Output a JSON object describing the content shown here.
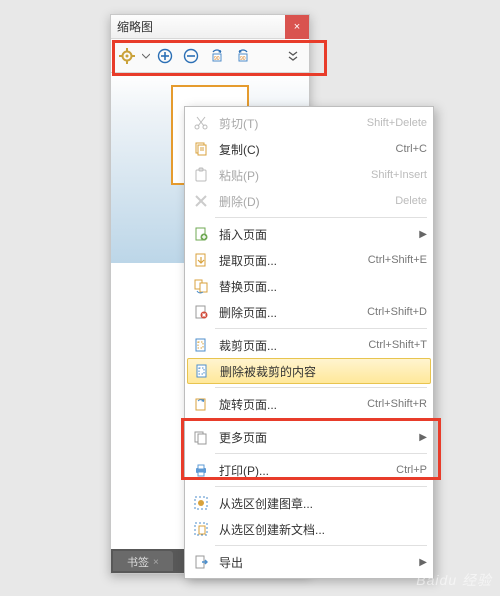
{
  "panel": {
    "title": "缩略图"
  },
  "tab": {
    "label": "书签",
    "close": "×"
  },
  "menu": {
    "cut": {
      "label": "剪切(T)",
      "shortcut": "Shift+Delete"
    },
    "copy": {
      "label": "复制(C)",
      "shortcut": "Ctrl+C"
    },
    "paste": {
      "label": "粘贴(P)",
      "shortcut": "Shift+Insert"
    },
    "delete": {
      "label": "删除(D)",
      "shortcut": "Delete"
    },
    "insert": {
      "label": "插入页面"
    },
    "extract": {
      "label": "提取页面...",
      "shortcut": "Ctrl+Shift+E"
    },
    "replace": {
      "label": "替换页面..."
    },
    "remove": {
      "label": "删除页面...",
      "shortcut": "Ctrl+Shift+D"
    },
    "crop": {
      "label": "裁剪页面...",
      "shortcut": "Ctrl+Shift+T"
    },
    "delcrop": {
      "label": "删除被裁剪的内容"
    },
    "rotate": {
      "label": "旋转页面...",
      "shortcut": "Ctrl+Shift+R"
    },
    "more": {
      "label": "更多页面"
    },
    "print": {
      "label": "打印(P)...",
      "shortcut": "Ctrl+P"
    },
    "selbmk": {
      "label": "从选区创建图章..."
    },
    "seldoc": {
      "label": "从选区创建新文档..."
    },
    "export": {
      "label": "导出"
    }
  },
  "watermark": "Baidu 经验"
}
